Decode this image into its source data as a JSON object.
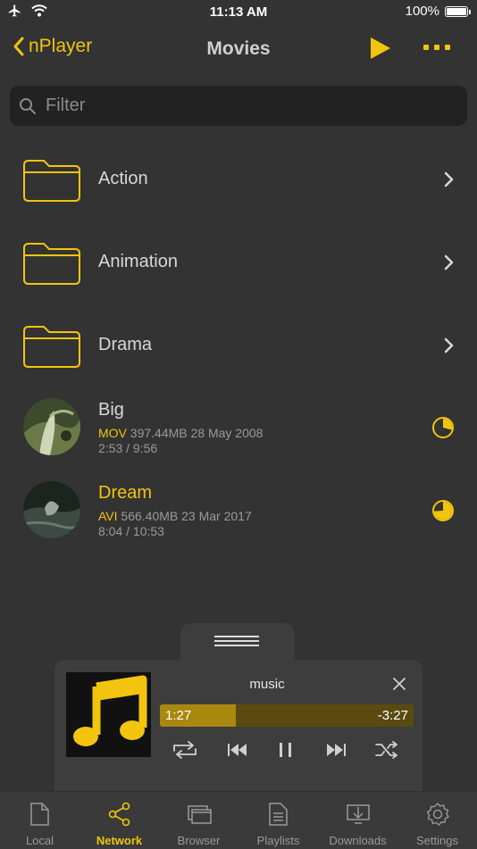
{
  "status_bar": {
    "time": "11:13 AM",
    "battery": "100%"
  },
  "navbar": {
    "back_label": "nPlayer",
    "title": "Movies"
  },
  "search": {
    "placeholder": "Filter"
  },
  "folders": [
    {
      "label": "Action"
    },
    {
      "label": "Animation"
    },
    {
      "label": "Drama"
    }
  ],
  "videos": [
    {
      "title": "Big",
      "format": "MOV",
      "size_date": "397.44MB 28 May 2008",
      "position": "2:53 / 9:56",
      "progress": 0.29,
      "highlighted": false
    },
    {
      "title": "Dream",
      "format": "AVI",
      "size_date": "566.40MB 23 Mar 2017",
      "position": "8:04 / 10:53",
      "progress": 0.74,
      "highlighted": true
    }
  ],
  "player": {
    "title": "music",
    "elapsed": "1:27",
    "remaining": "-3:27",
    "progress": 0.3
  },
  "tabs": [
    {
      "label": "Local",
      "icon": "document-icon"
    },
    {
      "label": "Network",
      "icon": "share-icon",
      "active": true
    },
    {
      "label": "Browser",
      "icon": "browser-windows-icon"
    },
    {
      "label": "Playlists",
      "icon": "list-document-icon"
    },
    {
      "label": "Downloads",
      "icon": "download-tray-icon"
    },
    {
      "label": "Settings",
      "icon": "gear-icon"
    }
  ],
  "colors": {
    "accent": "#f2c40e",
    "background": "#333333",
    "search_bg": "#222222"
  }
}
